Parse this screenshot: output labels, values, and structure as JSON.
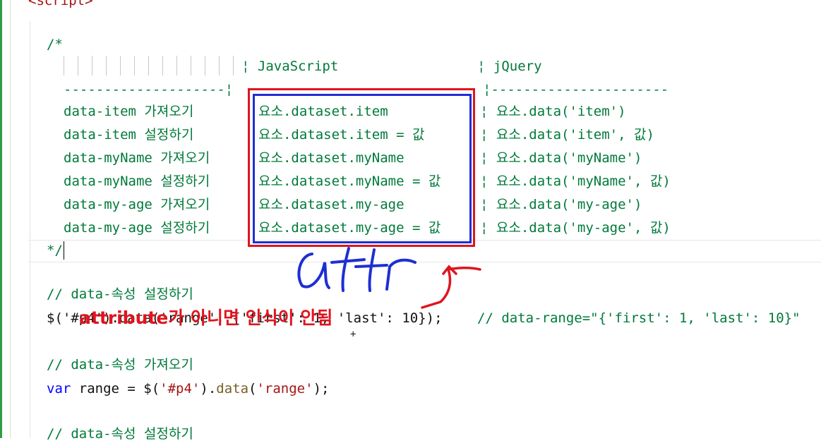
{
  "editor": {
    "top_partial": "<script>",
    "comment_open": "/*",
    "comment_close": "*/",
    "table_header": {
      "js": "¦ JavaScript",
      "jq": "¦ jQuery"
    },
    "dash_left": "--------------------¦",
    "dash_right": "¦----------------------",
    "rows": [
      {
        "label": "data-item 가져오기",
        "js": "요소.dataset.item",
        "jq": "¦ 요소.data('item')"
      },
      {
        "label": "data-item 설정하기",
        "js": "요소.dataset.item = 값",
        "jq": "¦ 요소.data('item', 값)"
      },
      {
        "label": "data-myName 가져오기",
        "js": "요소.dataset.myName",
        "jq": "¦ 요소.data('myName')"
      },
      {
        "label": "data-myName 설정하기",
        "js": "요소.dataset.myName = 값",
        "jq": "¦ 요소.data('myName', 값)"
      },
      {
        "label": "data-my-age 가져오기",
        "js": "요소.dataset.my-age",
        "jq": "¦ 요소.data('my-age')"
      },
      {
        "label": "data-my-age 설정하기",
        "js": "요소.dataset.my-age = 값",
        "jq": "¦ 요소.data('my-age', 값)"
      }
    ],
    "line_comment_set": "// data-속성 설정하기",
    "line_set_code_start": "$('#p4').data('range', {'first': 1, 'last': 10});",
    "line_set_comment": "// data-range=\"{'first': 1, 'last': 10}\"",
    "line_comment_get": "// data-속성 가져오기",
    "line_get_var": "var",
    "line_get_rest": " range = ",
    "line_get_dollar": "$(",
    "line_get_sel": "'#p4'",
    "line_get_close": ").",
    "line_get_fn": "data",
    "line_get_open": "(",
    "line_get_arg": "'range'",
    "line_get_end": ");",
    "line_comment_set2": "// data-속성 설정하기"
  },
  "annotation": {
    "handwritten": "attr",
    "overlay_text": "attribute가 아니면 인식이 안됨",
    "red_color": "#e0141e",
    "blue_color": "#1e2ed4"
  }
}
